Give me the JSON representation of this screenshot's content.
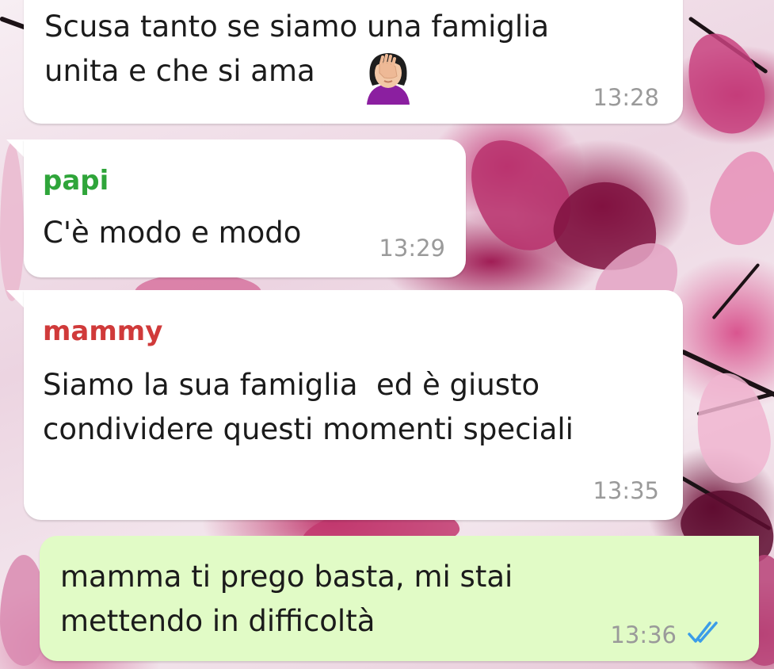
{
  "messages": [
    {
      "direction": "incoming",
      "sender": "",
      "text": "Scusa tanto se siamo una famiglia\nunita e che si ama",
      "emoji": "woman-facepalming-icon",
      "time": "13:28"
    },
    {
      "direction": "incoming",
      "sender": "papi",
      "sender_color": "#2fa53a",
      "text": "C'è modo e modo",
      "time": "13:29"
    },
    {
      "direction": "incoming",
      "sender": "mammy",
      "sender_color": "#d03a3a",
      "text": "Siamo la sua famiglia  ed è giusto\ncondividere questi momenti speciali",
      "time": "13:35"
    },
    {
      "direction": "outgoing",
      "text": "mamma ti prego basta, mi stai\nmettendo in difficoltà",
      "time": "13:36",
      "status_icon": "double-check-read-icon",
      "status_color": "#3b9ce8"
    }
  ],
  "colors": {
    "incoming_bubble": "#ffffff",
    "outgoing_bubble": "#e1fbc6",
    "timestamp": "#9a9a9a"
  }
}
